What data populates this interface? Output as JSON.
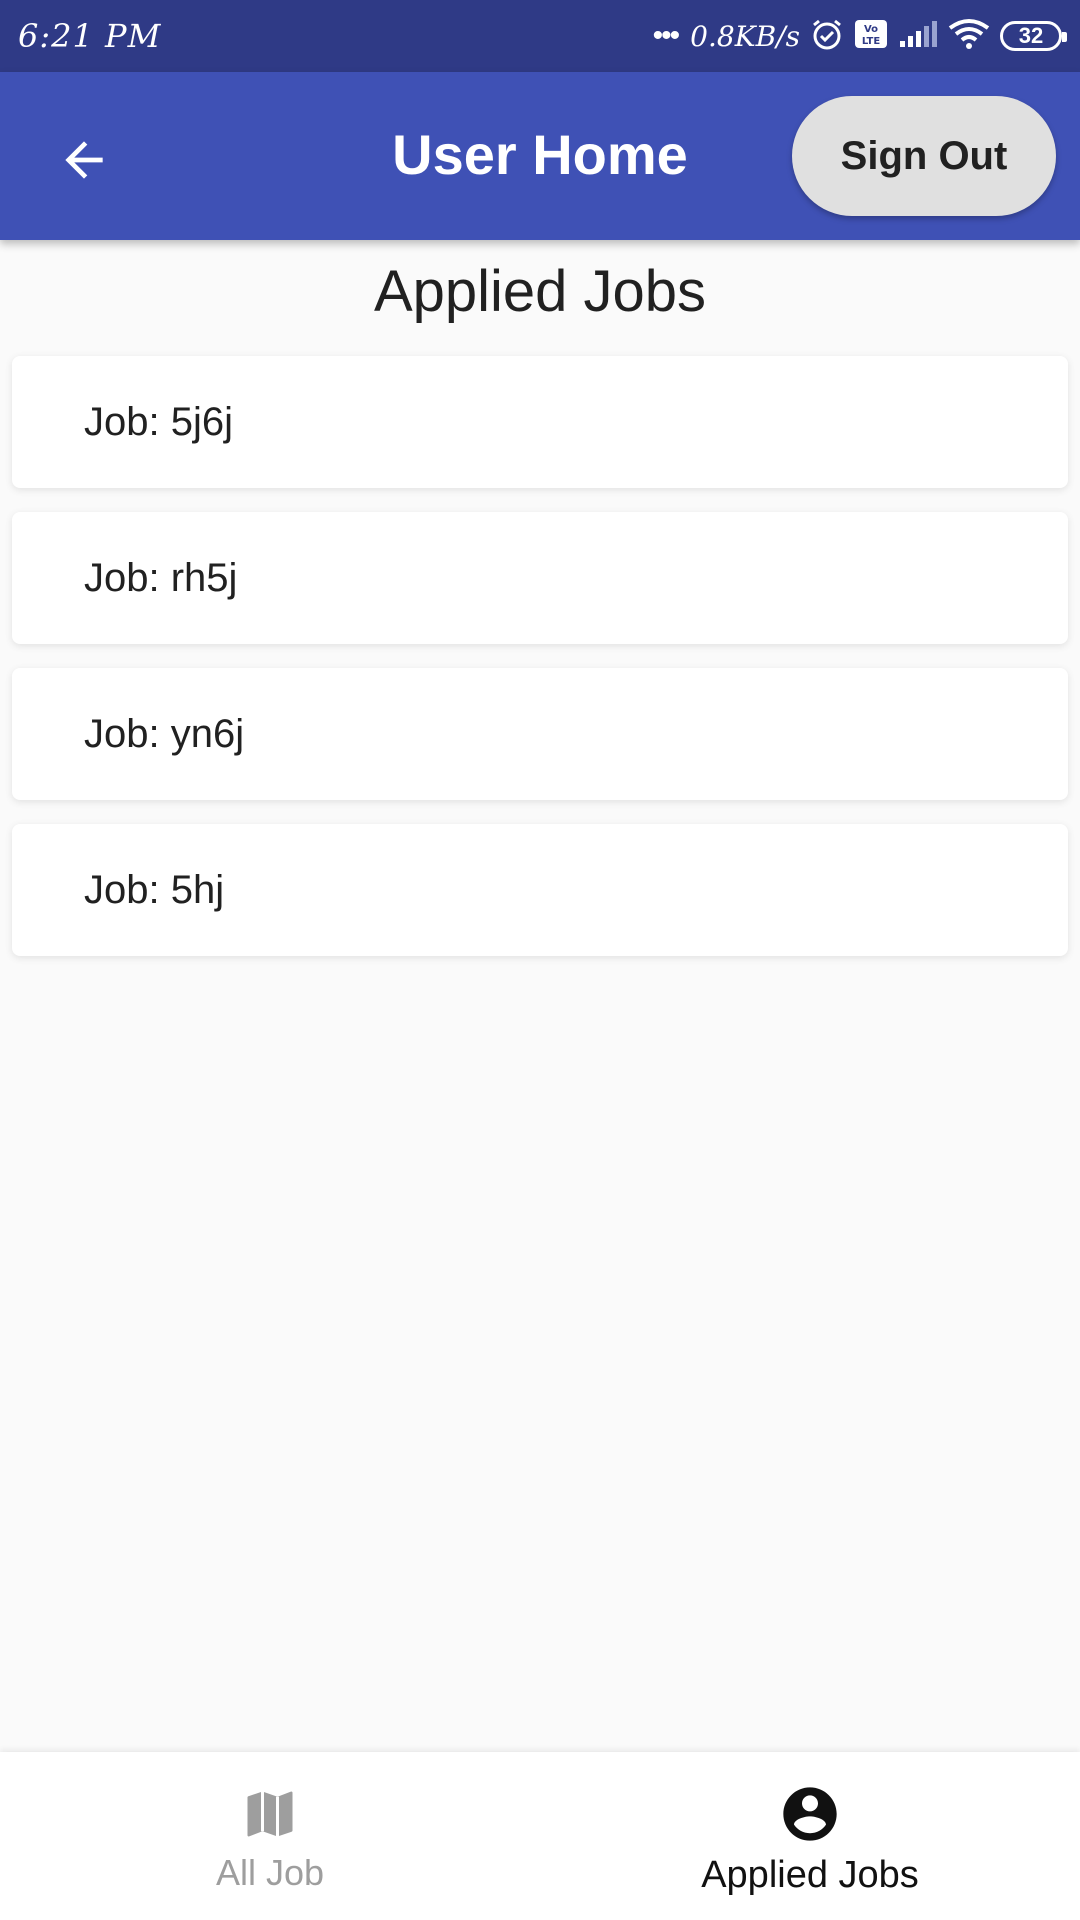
{
  "status_bar": {
    "time": "6:21 PM",
    "net_speed": "0.8KB/s",
    "battery": "32",
    "icons": [
      "alarm-icon",
      "volte-icon",
      "cellular-signal-icon",
      "wifi-icon",
      "battery-icon"
    ]
  },
  "app_bar": {
    "back_icon": "arrow-back-icon",
    "title": "User Home",
    "sign_out_label": "Sign Out",
    "color": "#3f51b5"
  },
  "main": {
    "section_title": "Applied Jobs",
    "jobs": [
      {
        "label": "Job: 5j6j"
      },
      {
        "label": "Job: rh5j"
      },
      {
        "label": "Job: yn6j"
      },
      {
        "label": "Job: 5hj"
      }
    ]
  },
  "bottom_nav": {
    "items": [
      {
        "label": "All Job",
        "icon": "map-icon",
        "active": false
      },
      {
        "label": "Applied Jobs",
        "icon": "account-circle-icon",
        "active": true
      }
    ]
  }
}
